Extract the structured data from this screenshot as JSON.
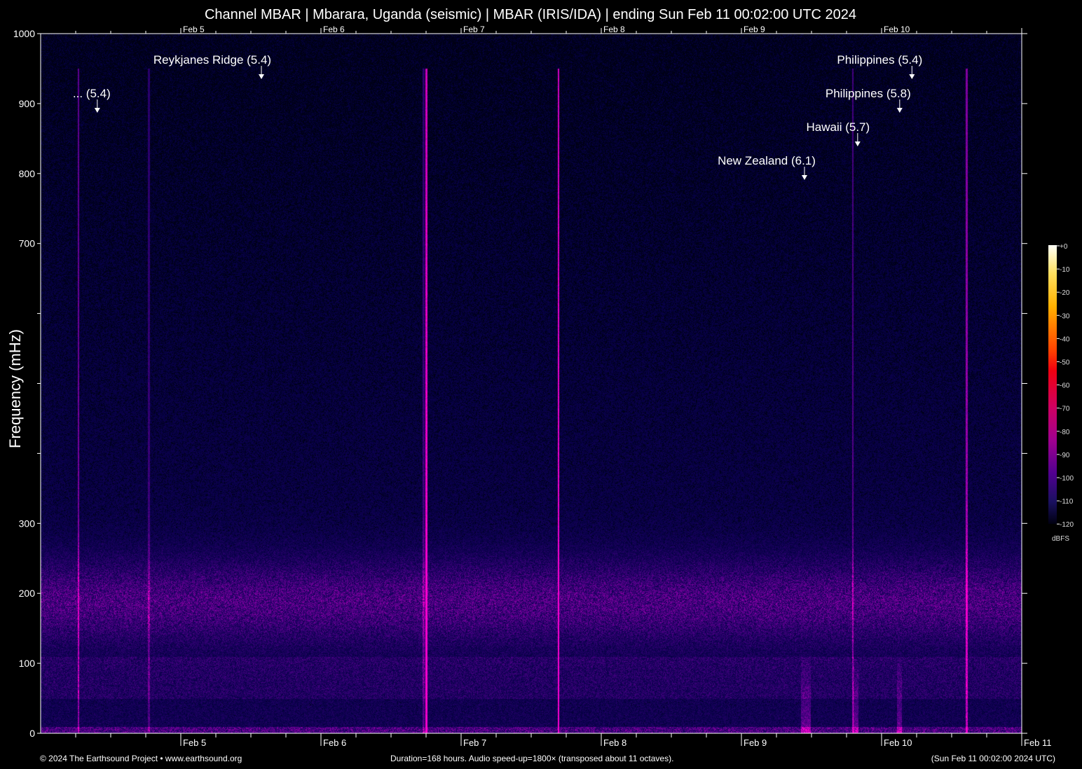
{
  "chart_data": {
    "type": "heatmap",
    "title": "Channel MBAR | Mbarara, Uganda (seismic) | MBAR (IRIS/IDA) | ending Sun Feb 11 00:02:00 UTC 2024",
    "ylabel": "Frequency (mHz)",
    "ylim": [
      0,
      1000
    ],
    "yticks": [
      0,
      100,
      200,
      300,
      400,
      500,
      600,
      700,
      800,
      900,
      1000
    ],
    "yticklabels": [
      "0",
      "100",
      "200",
      "300",
      "",
      "",
      "",
      "700",
      "800",
      "900",
      "1000"
    ],
    "x_range_hours": [
      0,
      168
    ],
    "xticklabels": [
      {
        "label": "Feb  5",
        "hour": 24
      },
      {
        "label": "Feb  6",
        "hour": 48
      },
      {
        "label": "Feb  7",
        "hour": 72
      },
      {
        "label": "Feb  8",
        "hour": 96
      },
      {
        "label": "Feb  9",
        "hour": 120
      },
      {
        "label": "Feb 10",
        "hour": 144
      },
      {
        "label": "Feb 11",
        "hour": 168
      }
    ],
    "colorbar": {
      "label": "dBFS",
      "ticks": [
        "+0",
        "-10",
        "-20",
        "-30",
        "-40",
        "-50",
        "-60",
        "-70",
        "-80",
        "-90",
        "-100",
        "-110",
        "-120"
      ],
      "range": [
        -120,
        0
      ]
    },
    "events": [
      {
        "label": "... (5.4)",
        "hour": 9.7
      },
      {
        "label": "Reykjanes Ridge (5.4)",
        "hour": 37.8
      },
      {
        "label": "New Zealand (6.1)",
        "hour": 130.8
      },
      {
        "label": "Hawaii (5.7)",
        "hour": 139.9
      },
      {
        "label": "Philippines (5.8)",
        "hour": 147.1
      },
      {
        "label": "Philippines (5.4)",
        "hour": 149.2
      }
    ]
  },
  "footer": {
    "left": "© 2024 The Earthsound Project • www.earthsound.org",
    "center": "Duration=168 hours. Audio speed-up=1800× (transposed about 11 octaves).",
    "right": "(Sun Feb 11 00:02:00 2024 UTC)"
  }
}
